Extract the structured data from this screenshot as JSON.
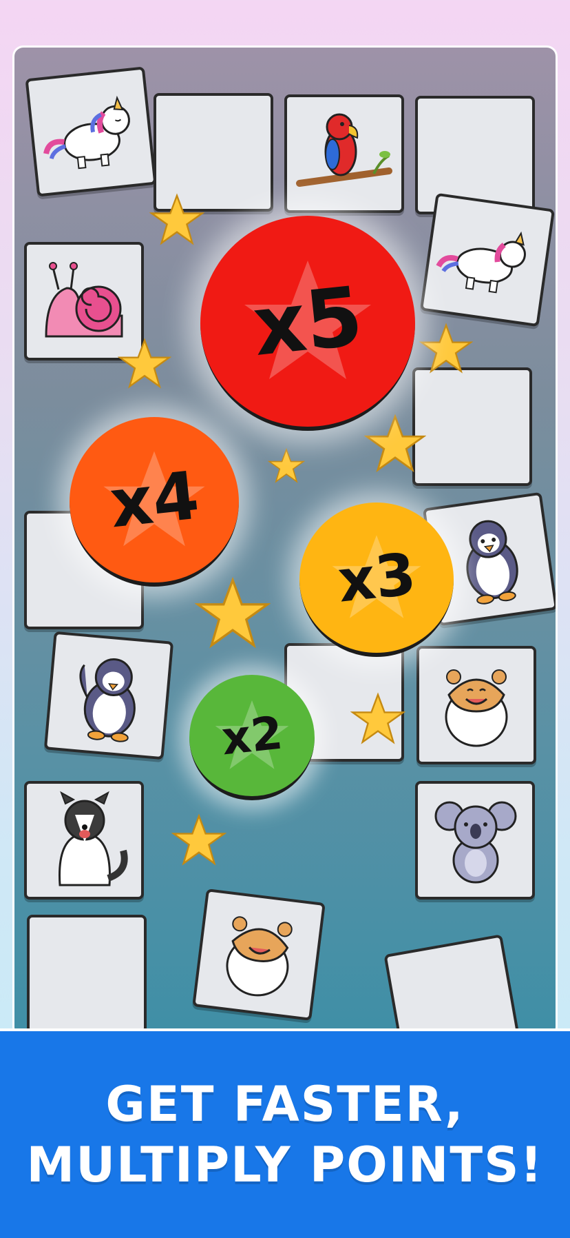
{
  "banner": {
    "line1": "GET FASTER,",
    "line2": "MULTIPLY POINTS!"
  },
  "multipliers": [
    {
      "label": "x5",
      "color": "#f01a14"
    },
    {
      "label": "x4",
      "color": "#ff5a12"
    },
    {
      "label": "x3",
      "color": "#ffb512"
    },
    {
      "label": "x2",
      "color": "#58b73a"
    }
  ],
  "cards": [
    {
      "name": "unicorn",
      "icon": "unicorn-icon"
    },
    {
      "name": "blank"
    },
    {
      "name": "parrot",
      "icon": "parrot-icon"
    },
    {
      "name": "blank"
    },
    {
      "name": "snail",
      "icon": "snail-icon"
    },
    {
      "name": "unicorn",
      "icon": "unicorn-icon"
    },
    {
      "name": "blank"
    },
    {
      "name": "blank"
    },
    {
      "name": "penguin",
      "icon": "penguin-icon"
    },
    {
      "name": "penguin",
      "icon": "penguin-icon"
    },
    {
      "name": "blank"
    },
    {
      "name": "hamster",
      "icon": "hamster-icon"
    },
    {
      "name": "dog",
      "icon": "dog-icon"
    },
    {
      "name": "koala",
      "icon": "koala-icon"
    },
    {
      "name": "blank"
    },
    {
      "name": "hamster",
      "icon": "hamster-icon"
    },
    {
      "name": "blank"
    }
  ],
  "colors": {
    "banner": "#1877e8",
    "star": "#ffc93c",
    "card": "#e6e8ec"
  }
}
